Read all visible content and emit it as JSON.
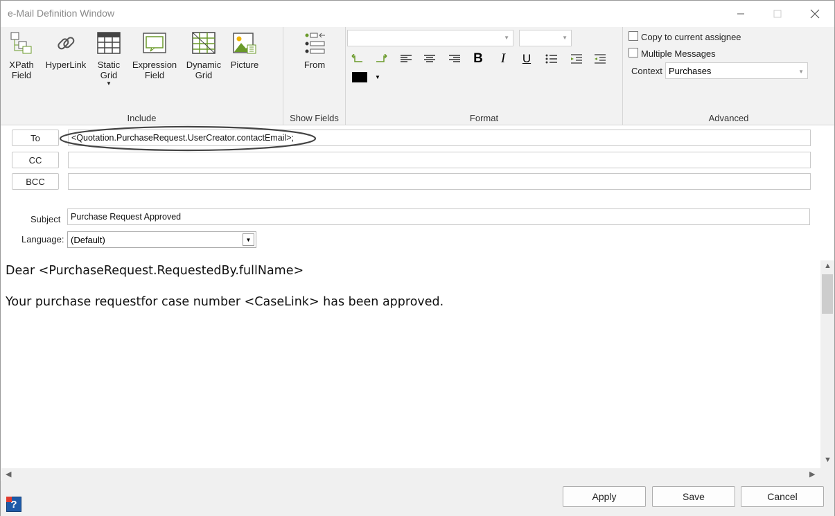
{
  "window": {
    "title": "e-Mail Definition Window"
  },
  "ribbon": {
    "include": {
      "label": "Include",
      "buttons": [
        {
          "line1": "XPath",
          "line2": "Field"
        },
        {
          "line1": "HyperLink",
          "line2": ""
        },
        {
          "line1": "Static",
          "line2": "Grid"
        },
        {
          "line1": "Expression",
          "line2": "Field"
        },
        {
          "line1": "Dynamic",
          "line2": "Grid"
        },
        {
          "line1": "Picture",
          "line2": ""
        }
      ]
    },
    "show_fields": {
      "label": "Show Fields",
      "from_label": "From"
    },
    "format": {
      "label": "Format",
      "font_value": "",
      "size_value": "",
      "color_value": "#000000"
    },
    "advanced": {
      "label": "Advanced",
      "copy_assignee": "Copy to current assignee",
      "multiple_messages": "Multiple Messages",
      "context_label": "Context",
      "context_value": "Purchases"
    }
  },
  "fields": {
    "to_button": "To",
    "cc_button": "CC",
    "bcc_button": "BCC",
    "to_value": "<Quotation.PurchaseRequest.UserCreator.contactEmail>;",
    "cc_value": "",
    "bcc_value": "",
    "subject_label": "Subject",
    "subject_value": "Purchase Request Approved",
    "language_label": "Language:",
    "language_value": "(Default)"
  },
  "body": {
    "line1": "Dear <PurchaseRequest.RequestedBy.fullName>",
    "line2": "Your purchase requestfor case number <CaseLink> has been approved."
  },
  "footer": {
    "apply": "Apply",
    "save": "Save",
    "cancel": "Cancel",
    "help_glyph": "?"
  }
}
